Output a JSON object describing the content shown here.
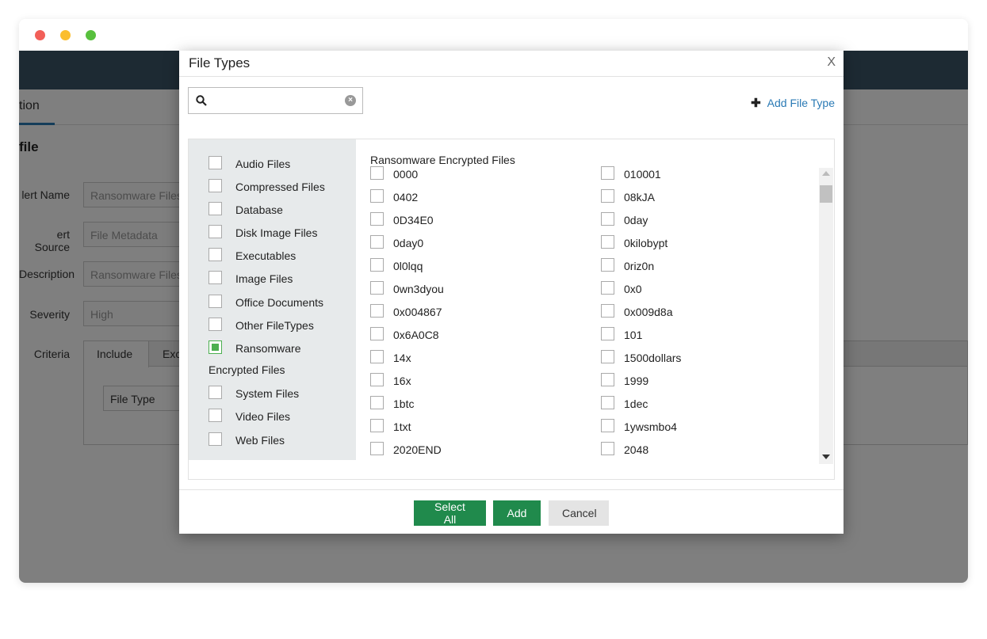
{
  "app": {
    "tab_label": "tion",
    "section_title": "file",
    "form": [
      {
        "label": "lert Name",
        "value": "Ransomware Files"
      },
      {
        "label": "ert Source",
        "value": "File Metadata"
      },
      {
        "label": "Description",
        "value": "Ransomware Files"
      },
      {
        "label": "Severity",
        "value": "High"
      }
    ],
    "criteria_label": "Criteria",
    "criteria_tabs": [
      "Include",
      "Exc"
    ],
    "criteria_select": "File Type"
  },
  "modal": {
    "title": "File Types",
    "close": "X",
    "search_placeholder": "",
    "add_file_type": "Add File Type",
    "categories": [
      {
        "label": "Audio Files",
        "checked": false
      },
      {
        "label": "Compressed Files",
        "checked": false
      },
      {
        "label": "Database",
        "checked": false
      },
      {
        "label": "Disk Image Files",
        "checked": false
      },
      {
        "label": "Executables",
        "checked": false
      },
      {
        "label": "Image Files",
        "checked": false
      },
      {
        "label": "Office Documents",
        "checked": false
      },
      {
        "label": "Other FileTypes",
        "checked": false
      },
      {
        "label": "Ransomware",
        "label_line2": "Encrypted Files",
        "checked": true
      },
      {
        "label": "System Files",
        "checked": false
      },
      {
        "label": "Video Files",
        "checked": false
      },
      {
        "label": "Web Files",
        "checked": false
      }
    ],
    "file_list_title": "Ransomware Encrypted Files",
    "files_left": [
      "0000",
      "0402",
      "0D34E0",
      "0day0",
      "0l0lqq",
      "0wn3dyou",
      "0x004867",
      "0x6A0C8",
      "14x",
      "16x",
      "1btc",
      "1txt",
      "2020END"
    ],
    "files_right": [
      "010001",
      "08kJA",
      "0day",
      "0kilobypt",
      "0riz0n",
      "0x0",
      "0x009d8a",
      "101",
      "1500dollars",
      "1999",
      "1dec",
      "1ywsmbo4",
      "2048"
    ],
    "buttons": {
      "select_all": "Select All",
      "add": "Add",
      "cancel": "Cancel"
    }
  }
}
